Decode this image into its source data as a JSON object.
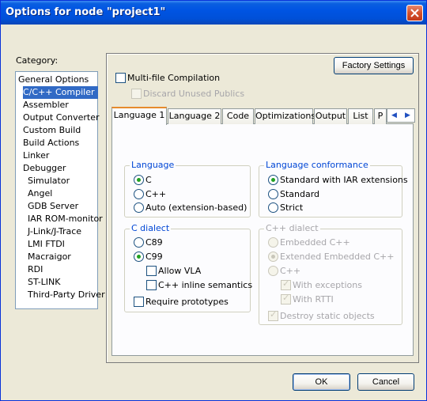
{
  "window": {
    "title": "Options for node \"project1\""
  },
  "category": {
    "label": "Category:",
    "items": [
      "General Options",
      "C/C++ Compiler",
      "Assembler",
      "Output Converter",
      "Custom Build",
      "Build Actions",
      "Linker",
      "Debugger",
      "Simulator",
      "Angel",
      "GDB Server",
      "IAR ROM-monitor",
      "J-Link/J-Trace",
      "LMI FTDI",
      "Macraigor",
      "RDI",
      "ST-LINK",
      "Third-Party Driver"
    ],
    "selected": "C/C++ Compiler"
  },
  "top": {
    "factory_settings": "Factory Settings",
    "multi_file": "Multi-file Compilation",
    "discard_unused": "Discard Unused Publics"
  },
  "tabs": [
    "Language 1",
    "Language 2",
    "Code",
    "Optimizations",
    "Output",
    "List",
    "P"
  ],
  "language": {
    "title": "Language",
    "options": [
      "C",
      "C++",
      "Auto (extension-based)"
    ],
    "selected": "C"
  },
  "conformance": {
    "title": "Language conformance",
    "options": [
      "Standard with IAR extensions",
      "Standard",
      "Strict"
    ],
    "selected": "Standard with IAR extensions"
  },
  "c_dialect": {
    "title": "C dialect",
    "options": [
      "C89",
      "C99"
    ],
    "selected": "C99",
    "allow_vla": "Allow VLA",
    "cpp_inline": "C++ inline semantics",
    "require_prototypes": "Require prototypes"
  },
  "cpp_dialect": {
    "title": "C++ dialect",
    "options": [
      "Embedded C++",
      "Extended Embedded C++",
      "C++"
    ],
    "selected": "Extended Embedded C++",
    "with_exceptions": "With exceptions",
    "with_rtti": "With RTTI",
    "destroy_static": "Destroy static objects"
  },
  "buttons": {
    "ok": "OK",
    "cancel": "Cancel"
  },
  "colors": {
    "accent": "#316ac5",
    "title_bar": "#0054e3",
    "group_title": "#0046d5",
    "check": "#21a121"
  }
}
